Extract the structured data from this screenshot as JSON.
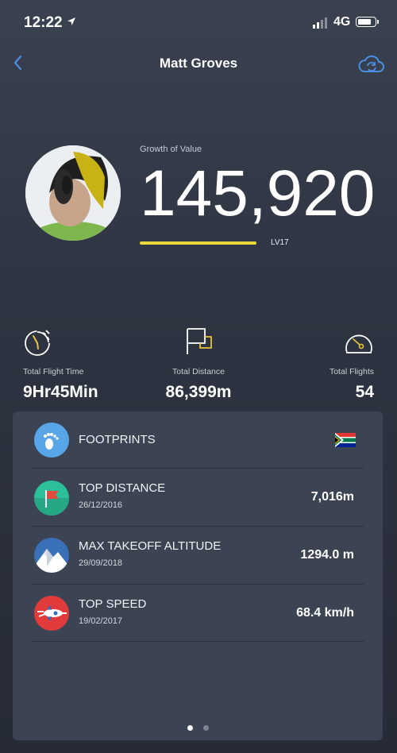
{
  "status_bar": {
    "time": "12:22",
    "network": "4G"
  },
  "nav": {
    "title": "Matt Groves"
  },
  "profile": {
    "growth_label": "Growth of Value",
    "growth_value": "145,920",
    "level": "LV17"
  },
  "stats": [
    {
      "label": "Total Flight Time",
      "value": "9Hr45Min",
      "icon": "stopwatch-icon"
    },
    {
      "label": "Total Distance",
      "value": "86,399m",
      "icon": "flag-icon"
    },
    {
      "label": "Total Flights",
      "value": "54",
      "icon": "speedometer-icon"
    }
  ],
  "records": [
    {
      "title": "FOOTPRINTS",
      "icon": "footprints-icon",
      "extra": "south-africa-flag-icon"
    },
    {
      "title": "TOP DISTANCE",
      "date": "26/12/2016",
      "value": "7,016m",
      "icon": "red-flag-icon"
    },
    {
      "title": "MAX TAKEOFF ALTITUDE",
      "date": "29/09/2018",
      "value": "1294.0 m",
      "icon": "mountain-icon"
    },
    {
      "title": "TOP SPEED",
      "date": "19/02/2017",
      "value": "68.4 km/h",
      "icon": "rocket-icon"
    }
  ],
  "pagination": {
    "pages": 2,
    "current": 1
  },
  "colors": {
    "accent": "#4a90e2",
    "level_bar": "#e9d93a",
    "card": "#3c4352"
  }
}
